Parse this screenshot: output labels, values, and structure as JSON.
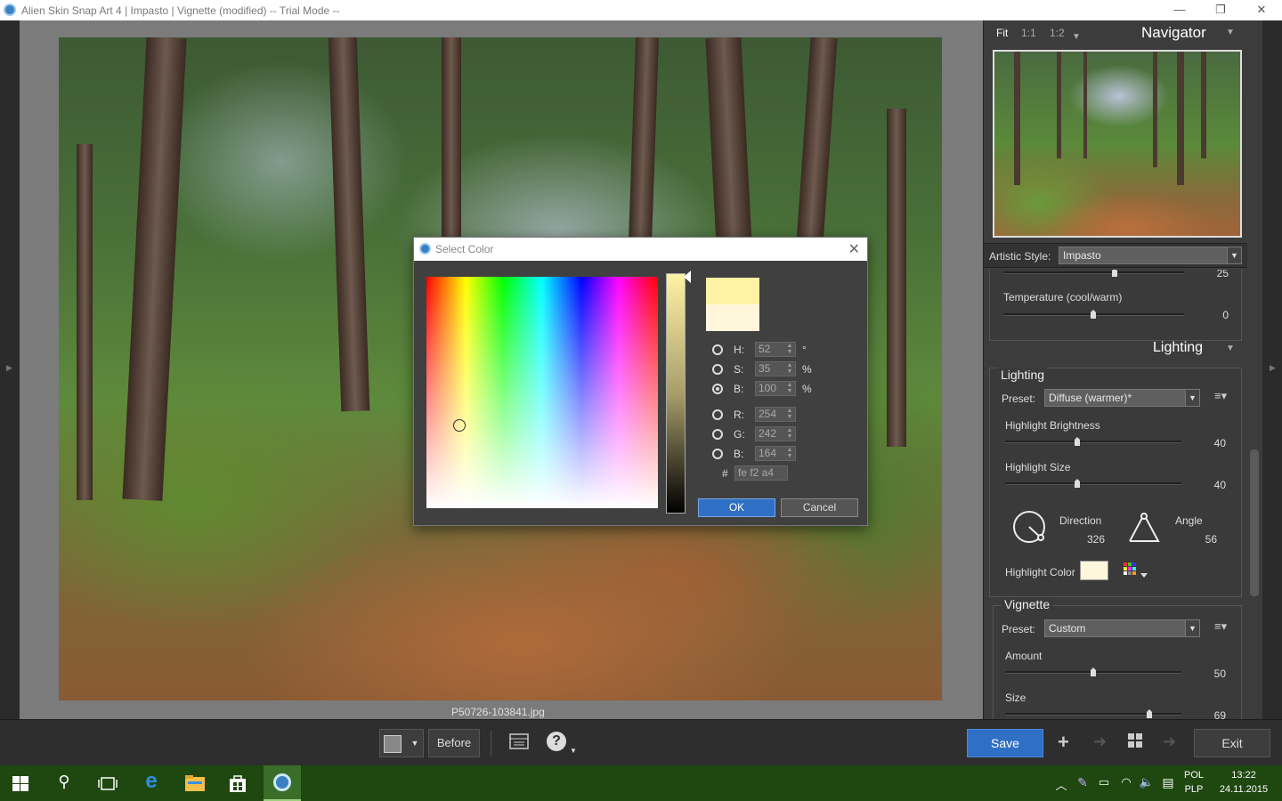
{
  "window": {
    "title": "Alien Skin Snap Art 4 | Impasto | Vignette (modified) -- Trial Mode --"
  },
  "window_controls": {
    "minimize": "—",
    "restore": "❐",
    "close": "✕"
  },
  "canvas": {
    "filename": "P50726-103841.jpg"
  },
  "navigator": {
    "zoom_options": [
      "Fit",
      "1:1",
      "1:2"
    ],
    "title": "Navigator"
  },
  "artistic_style": {
    "label": "Artistic Style:",
    "value": "Impasto"
  },
  "panel": {
    "top_partial_value": "25",
    "temperature": {
      "label": "Temperature (cool/warm)",
      "value": "0"
    },
    "lighting_section_title": "Lighting",
    "lighting": {
      "group_title": "Lighting",
      "preset_label": "Preset:",
      "preset_value": "Diffuse (warmer)*",
      "highlight_brightness": {
        "label": "Highlight Brightness",
        "value": "40"
      },
      "highlight_size": {
        "label": "Highlight Size",
        "value": "40"
      },
      "direction": {
        "label": "Direction",
        "value": "326"
      },
      "angle": {
        "label": "Angle",
        "value": "56"
      },
      "highlight_color_label": "Highlight Color",
      "highlight_color": "#fff6dc"
    },
    "vignette": {
      "group_title": "Vignette",
      "preset_label": "Preset:",
      "preset_value": "Custom",
      "amount": {
        "label": "Amount",
        "value": "50"
      },
      "size": {
        "label": "Size",
        "value": "69"
      }
    }
  },
  "toolbar": {
    "before_label": "Before",
    "save_label": "Save",
    "exit_label": "Exit",
    "help_icon": "?",
    "add_icon": "+"
  },
  "dialog": {
    "title": "Select Color",
    "fields": {
      "h": {
        "label": "H:",
        "value": "52",
        "unit": "°"
      },
      "s": {
        "label": "S:",
        "value": "35",
        "unit": "%"
      },
      "b": {
        "label": "B:",
        "value": "100",
        "unit": "%"
      },
      "r": {
        "label": "R:",
        "value": "254"
      },
      "g": {
        "label": "G:",
        "value": "242"
      },
      "b2": {
        "label": "B:",
        "value": "164"
      }
    },
    "hex_label": "#",
    "hex_value": "fe f2 a4",
    "ok_label": "OK",
    "cancel_label": "Cancel",
    "new_color": "#fef2a4",
    "old_color": "#fff6dc"
  },
  "taskbar": {
    "lang_top": "POL",
    "lang_bottom": "PLP",
    "time": "13:22",
    "date": "24.11.2015"
  },
  "colors": {
    "accent": "#2f6fc4",
    "panel_bg": "#3c3c3c",
    "taskbar_bg": "#1f4710"
  }
}
